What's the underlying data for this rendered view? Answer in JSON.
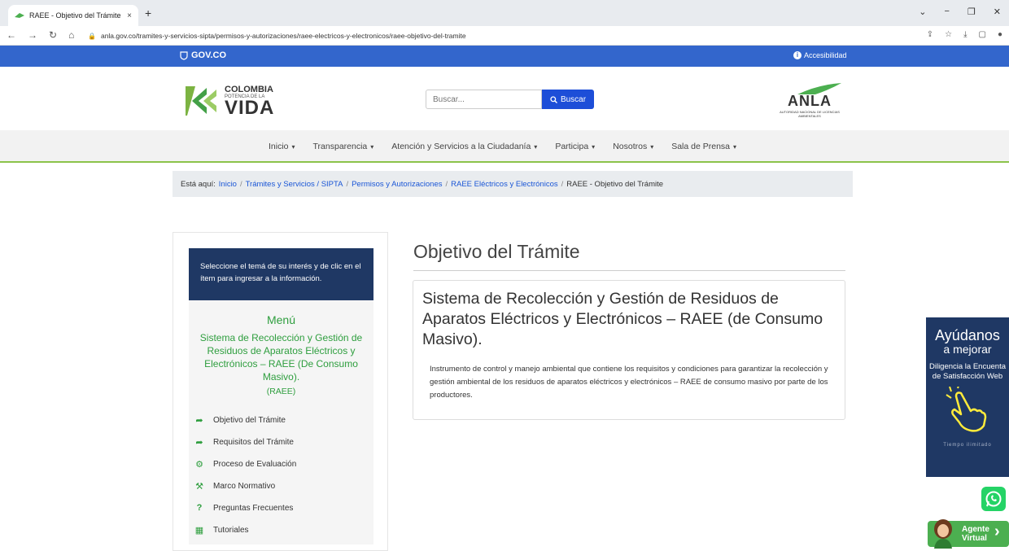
{
  "browser": {
    "tab_title": "RAEE - Objetivo del Trámite",
    "tab_close": "×",
    "new_tab": "+",
    "url": "anla.gov.co/tramites-y-servicios-sipta/permisos-y-autorizaciones/raee-electricos-y-electronicos/raee-objetivo-del-tramite"
  },
  "govbar": {
    "logo": "GOV.CO",
    "accessibility": "Accesibilidad"
  },
  "header": {
    "logo_line1": "COLOMBIA",
    "logo_line2": "POTENCIA DE LA",
    "logo_line3": "VIDA",
    "search_placeholder": "Buscar...",
    "search_button": "Buscar",
    "anla_name": "ANLA",
    "anla_sub": "AUTORIDAD NACIONAL DE LICENCIAS AMBIENTALES"
  },
  "menu": [
    "Inicio",
    "Transparencia",
    "Atención y Servicios a la Ciudadanía",
    "Participa",
    "Nosotros",
    "Sala de Prensa"
  ],
  "breadcrumb": {
    "prefix": "Está aquí:",
    "links": [
      "Inicio",
      "Trámites y Servicios / SIPTA",
      "Permisos y Autorizaciones",
      "RAEE Eléctricos y Electrónicos"
    ],
    "current": "RAEE - Objetivo del Trámite"
  },
  "sidebar": {
    "intro": "Seleccione el temá de su interés y de clic en el ítem para ingresar a la información.",
    "menu_title": "Menú",
    "menu_desc": "Sistema de Recolección y Gestión de Residuos de Aparatos Eléctricos y Electrónicos – RAEE (De Consumo Masivo).",
    "abbr": "(RAEE)",
    "items": [
      {
        "label": "Objetivo del Trámite",
        "icon": "share-arrow-icon"
      },
      {
        "label": "Requisitos del Trámite",
        "icon": "share-arrow-icon"
      },
      {
        "label": "Proceso de Evaluación",
        "icon": "cogs-icon"
      },
      {
        "label": "Marco Normativo",
        "icon": "gavel-icon"
      },
      {
        "label": "Preguntas Frecuentes",
        "icon": "question-icon"
      },
      {
        "label": "Tutoriales",
        "icon": "grid-icon"
      }
    ]
  },
  "main": {
    "title": "Objetivo del Trámite",
    "card_title": "Sistema de Recolección y Gestión de Residuos de Aparatos Eléctricos y Electrónicos – RAEE (de Consumo Masivo).",
    "card_text": "Instrumento de control y manejo ambiental que contiene los requisitos y condiciones para garantizar la recolección y gestión ambiental de los residuos de aparatos eléctricos y electrónicos – RAEE de consumo masivo por parte de los productores."
  },
  "survey": {
    "line1": "Ayúdanos",
    "line2": "a mejorar",
    "line3": "Diligencia la Encuenta de Satisfacción Web",
    "line4": "Tiempo ilimitado"
  },
  "agent": {
    "line1": "Agente",
    "line2": "Virtual"
  },
  "colors": {
    "govbar": "#3366cc",
    "accent_green": "#2e9e3e",
    "navy": "#1f3864",
    "link": "#1a56d6"
  }
}
